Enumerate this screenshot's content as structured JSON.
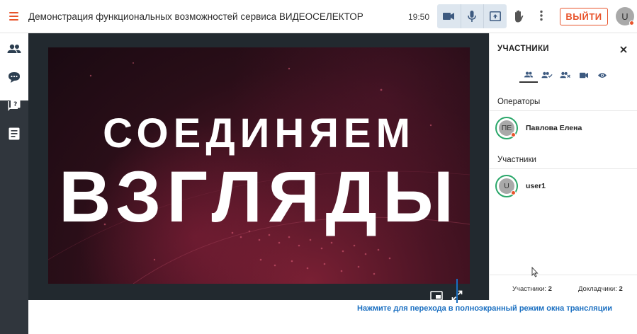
{
  "header": {
    "title": "Демонстрация функциональных возможностей сервиса ВИДЕОСЕЛЕКТОР",
    "time": "19:50",
    "exit_label": "ВЫЙТИ",
    "user_initial": "U",
    "accent": "#e8542c"
  },
  "sidebar": {
    "items": [
      "participants-icon",
      "chat-icon",
      "questions-icon",
      "notes-icon"
    ]
  },
  "video": {
    "line1": "СОЕДИНЯЕМ",
    "line2": "ВЗГЛЯДЫ"
  },
  "panel": {
    "title": "УЧАСТНИКИ",
    "tabs": [
      "all-participants-icon",
      "approved-icon",
      "removed-icon",
      "camera-icon",
      "viewers-icon"
    ],
    "operators_label": "Операторы",
    "operators": [
      {
        "initials": "ПЕ",
        "name": "Павлова Елена"
      }
    ],
    "participants_label": "Участники",
    "participants": [
      {
        "initials": "U",
        "name": "user1"
      }
    ],
    "footer_participants_label": "Участники:",
    "footer_participants_count": "2",
    "footer_speakers_label": "Докладчики:",
    "footer_speakers_count": "2"
  },
  "annotation": {
    "caption": "Нажмите для перехода в полноэкранный режим окна трансляции",
    "color": "#1a6fc1"
  }
}
